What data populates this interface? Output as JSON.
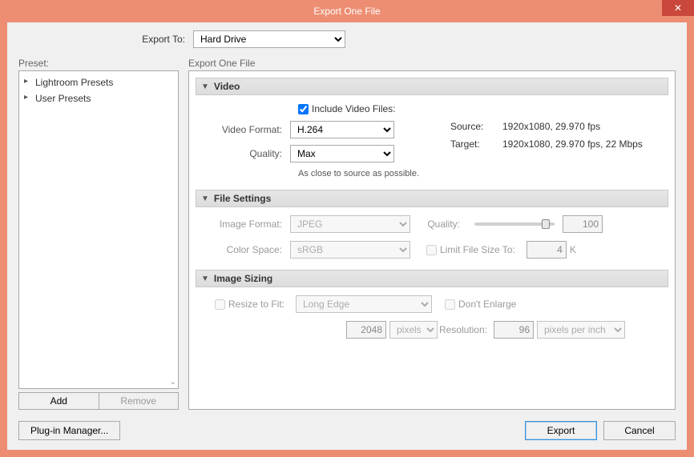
{
  "window": {
    "title": "Export One File"
  },
  "exportTo": {
    "label": "Export To:",
    "value": "Hard Drive"
  },
  "preset": {
    "header": "Preset:",
    "items": [
      "Lightroom Presets",
      "User Presets"
    ],
    "add": "Add",
    "remove": "Remove"
  },
  "settings": {
    "header": "Export One File"
  },
  "video": {
    "title": "Video",
    "include_label": "Include Video Files:",
    "format_label": "Video Format:",
    "format_value": "H.264",
    "quality_label": "Quality:",
    "quality_value": "Max",
    "note": "As close to source as possible.",
    "source_label": "Source:",
    "source_value": "1920x1080, 29.970 fps",
    "target_label": "Target:",
    "target_value": "1920x1080, 29.970 fps, 22 Mbps"
  },
  "file": {
    "title": "File Settings",
    "format_label": "Image Format:",
    "format_value": "JPEG",
    "quality_label": "Quality:",
    "quality_value": "100",
    "colorspace_label": "Color Space:",
    "colorspace_value": "sRGB",
    "limit_label": "Limit File Size To:",
    "limit_value": "4",
    "limit_unit": "K"
  },
  "sizing": {
    "title": "Image Sizing",
    "resize_label": "Resize to Fit:",
    "resize_mode": "Long Edge",
    "dont_enlarge": "Don't Enlarge",
    "dim_value": "2048",
    "dim_unit": "pixels",
    "res_label": "Resolution:",
    "res_value": "96",
    "res_unit": "pixels per inch"
  },
  "footer": {
    "plugin": "Plug-in Manager...",
    "export": "Export",
    "cancel": "Cancel"
  }
}
